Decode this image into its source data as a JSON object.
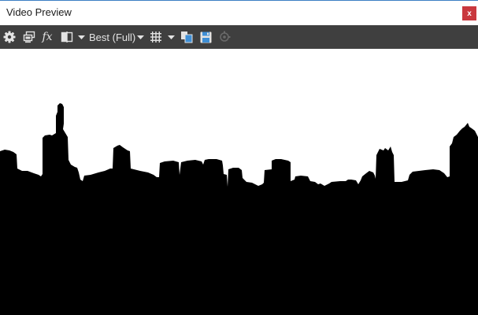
{
  "window": {
    "title": "Video Preview",
    "close_label": "x"
  },
  "toolbar": {
    "quality_label": "Best (Full)",
    "buttons": [
      {
        "name": "settings-icon"
      },
      {
        "name": "preview-device-icon"
      },
      {
        "name": "fx-icon",
        "label": "fx"
      },
      {
        "name": "split-screen-icon"
      },
      {
        "name": "split-dropdown-icon"
      },
      {
        "name": "quality-dropdown-icon"
      },
      {
        "name": "grid-icon"
      },
      {
        "name": "grid-dropdown-icon"
      },
      {
        "name": "copy-snapshot-icon"
      },
      {
        "name": "save-snapshot-icon"
      },
      {
        "name": "external-monitor-icon"
      }
    ]
  },
  "colors": {
    "title_border": "#3c7fc4",
    "toolbar_bg": "#3f3f3f",
    "close_bg": "#c9383e",
    "icon": "#e3e3e3",
    "accent": "#3f8fd6",
    "disabled_icon": "#6a6a6a"
  },
  "preview": {
    "content": "city-skyline-silhouette"
  }
}
